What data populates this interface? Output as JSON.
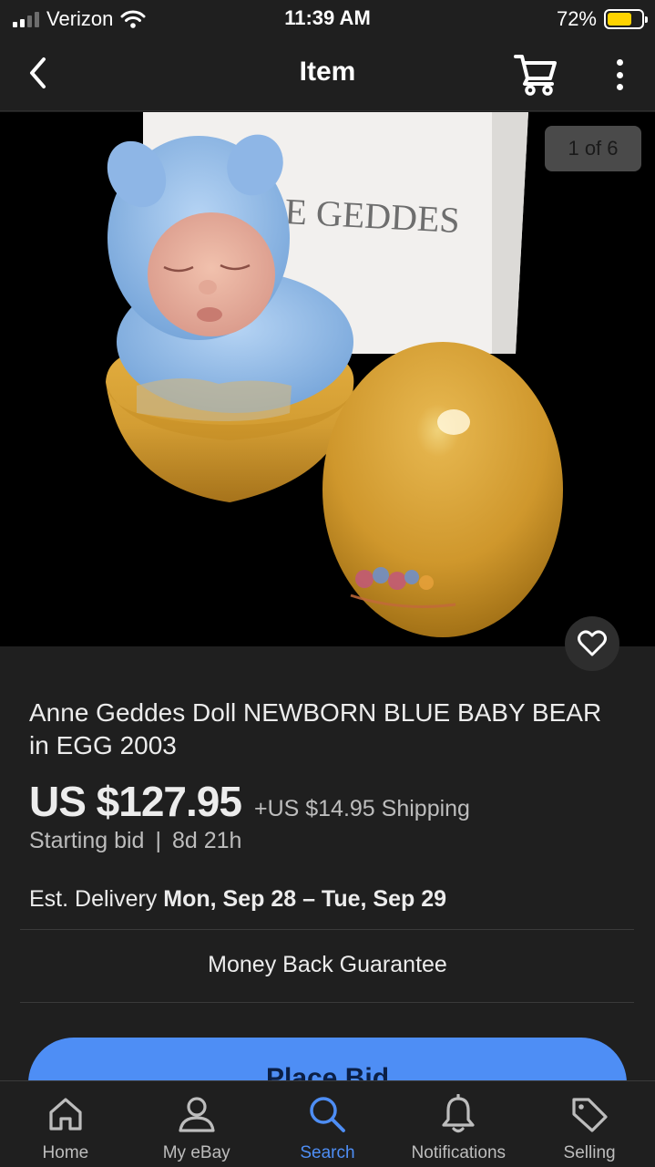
{
  "status_bar": {
    "carrier": "Verizon",
    "time": "11:39 AM",
    "battery_percent": "72%",
    "battery_level": 0.72,
    "battery_color": "#ffd400"
  },
  "nav": {
    "back_icon": "chevron-left-icon",
    "title": "Item",
    "cart_icon": "cart-icon",
    "more_icon": "more-vertical-icon"
  },
  "gallery": {
    "counter": "1 of 6",
    "box_text": "E GEDDES",
    "watch_icon": "heart-icon"
  },
  "listing": {
    "title": "Anne Geddes Doll NEWBORN BLUE BABY BEAR in EGG 2003",
    "price": "US $127.95",
    "shipping": "+US $14.95 Shipping",
    "bid_type": "Starting bid",
    "separator": "|",
    "time_left": "8d 21h",
    "delivery_label": "Est. Delivery",
    "delivery_dates": "Mon, Sep 28 – Tue, Sep 29",
    "guarantee": "Money Back Guarantee",
    "place_bid_label": "Place Bid"
  },
  "tab_bar": {
    "active_color": "#4e8ef5",
    "tabs": [
      {
        "label": "Home",
        "icon": "home-icon"
      },
      {
        "label": "My eBay",
        "icon": "user-icon"
      },
      {
        "label": "Search",
        "icon": "search-icon",
        "active": true
      },
      {
        "label": "Notifications",
        "icon": "bell-icon"
      },
      {
        "label": "Selling",
        "icon": "tag-icon"
      }
    ]
  }
}
